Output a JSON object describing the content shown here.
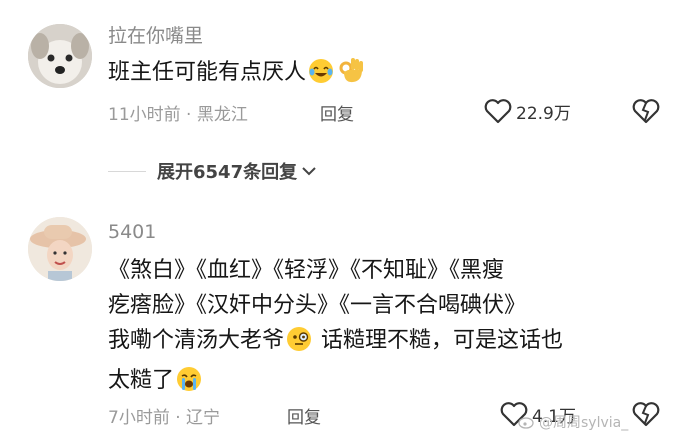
{
  "comments": [
    {
      "username": "拉在你嘴里",
      "text_parts": [
        "班主任可能有点厌人"
      ],
      "emoji_names": [
        "laughing-tears-emoji",
        "ok-hand-emoji"
      ],
      "time": "11小时前 · 黑龙江",
      "reply_label": "回复",
      "likes": "22.9万",
      "avatar_icon": "dog-avatar"
    },
    {
      "username": "5401",
      "text_line1": "《煞白》《血红》《轻浮》《不知耻》《黑瘦",
      "text_line2": "疙瘩脸》《汉奸中分头》《一言不合喝碘伏》",
      "text_line3a": "我嘞个清汤大老爷",
      "text_line3b": "话糙理不糙，可是这话也",
      "text_line4": "太糙了",
      "emoji_names": [
        "monocle-emoji",
        "crying-emoji"
      ],
      "time": "7小时前 · 辽宁",
      "reply_label": "回复",
      "likes": "4.1万",
      "avatar_icon": "woman-hat-avatar"
    }
  ],
  "expand_label": "展开6547条回复",
  "watermark": "@周周sylvia_"
}
